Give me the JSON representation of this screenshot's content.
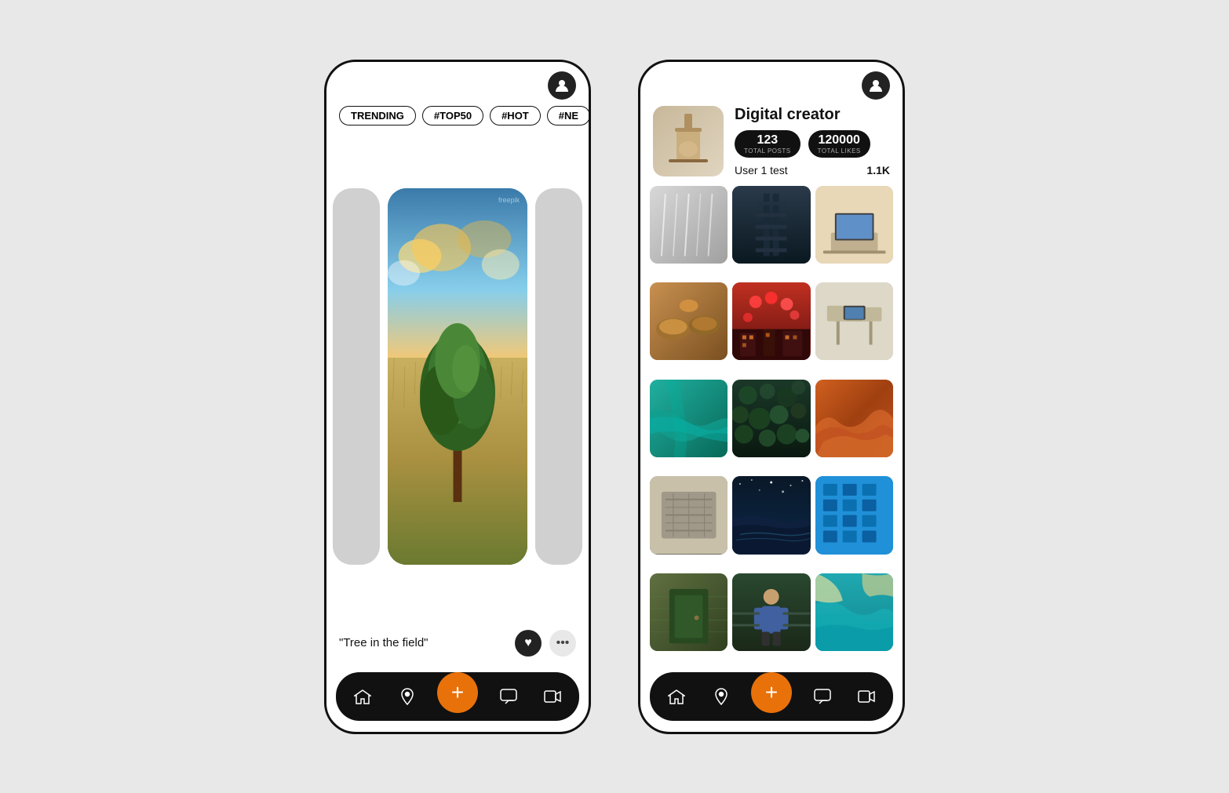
{
  "left_phone": {
    "profile_icon": "👤",
    "tags": [
      "TRENDING",
      "#TOP50",
      "#HOT",
      "#NE"
    ],
    "card_caption": "\"Tree in the field\"",
    "bottom_nav": {
      "icons": [
        "⬡",
        "📍",
        "+",
        "💬",
        "🎥"
      ]
    }
  },
  "right_phone": {
    "profile_icon": "👤",
    "profile": {
      "title": "Digital creator",
      "stats": [
        {
          "number": "123",
          "label": "TOTAL POSTS"
        },
        {
          "number": "120000",
          "label": "TOTAL LIKES"
        }
      ],
      "user_name": "User 1 test",
      "followers": "1.1K"
    },
    "grid_items": [
      {
        "class": "gi-1"
      },
      {
        "class": "gi-2"
      },
      {
        "class": "gi-3"
      },
      {
        "class": "gi-4"
      },
      {
        "class": "gi-5"
      },
      {
        "class": "gi-6"
      },
      {
        "class": "gi-7"
      },
      {
        "class": "gi-8"
      },
      {
        "class": "gi-9"
      },
      {
        "class": "gi-10"
      },
      {
        "class": "gi-11"
      },
      {
        "class": "gi-12"
      },
      {
        "class": "gi-13"
      },
      {
        "class": "gi-14"
      },
      {
        "class": "gi-15"
      }
    ],
    "bottom_nav": {
      "icons": [
        "⬡",
        "📍",
        "+",
        "💬",
        "🎥"
      ]
    }
  }
}
